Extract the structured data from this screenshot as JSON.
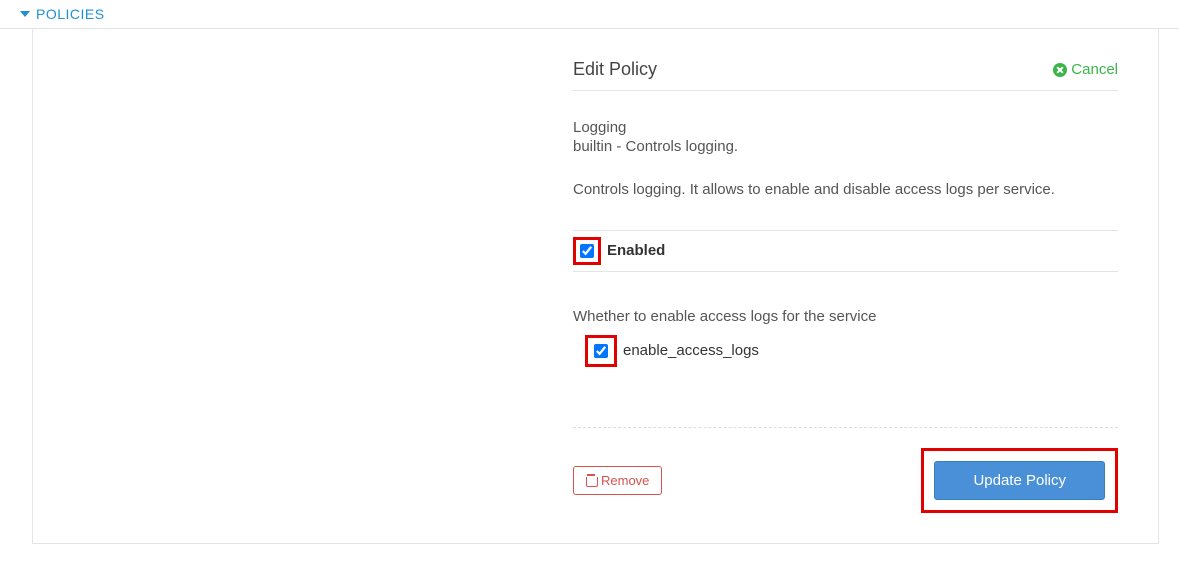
{
  "section": {
    "title": "POLICIES"
  },
  "header": {
    "title": "Edit Policy",
    "cancel_label": "Cancel"
  },
  "policy": {
    "name": "Logging",
    "subtitle": "builtin - Controls logging.",
    "description": "Controls logging. It allows to enable and disable access logs per service."
  },
  "enabled": {
    "label": "Enabled",
    "checked": true
  },
  "field": {
    "description": "Whether to enable access logs for the service",
    "name": "enable_access_logs",
    "checked": true
  },
  "actions": {
    "remove_label": "Remove",
    "update_label": "Update Policy"
  }
}
